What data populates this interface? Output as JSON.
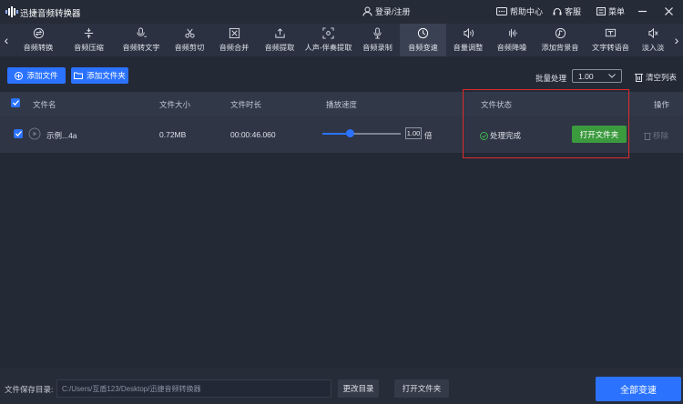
{
  "app": {
    "title": "迅捷音频转换器",
    "login": "登录/注册",
    "help": "帮助中心",
    "service": "客服",
    "menu": "菜单"
  },
  "tabs": [
    {
      "label": "音频转换",
      "icon": "convert-icon"
    },
    {
      "label": "音频压缩",
      "icon": "compress-icon"
    },
    {
      "label": "音频转文字",
      "icon": "speech-to-text-icon"
    },
    {
      "label": "音频剪切",
      "icon": "scissors-icon"
    },
    {
      "label": "音频合并",
      "icon": "merge-icon"
    },
    {
      "label": "音频提取",
      "icon": "extract-icon"
    },
    {
      "label": "人声-伴奏提取",
      "icon": "vocal-extract-icon"
    },
    {
      "label": "音频录制",
      "icon": "microphone-icon"
    },
    {
      "label": "音频变速",
      "icon": "clock-icon",
      "active": true
    },
    {
      "label": "音量调整",
      "icon": "volume-icon"
    },
    {
      "label": "音频降噪",
      "icon": "denoise-icon"
    },
    {
      "label": "添加背景音",
      "icon": "background-music-icon"
    },
    {
      "label": "文字转语音",
      "icon": "text-to-speech-icon"
    },
    {
      "label": "淡入淡",
      "icon": "fade-icon"
    }
  ],
  "actions": {
    "add_file": "添加文件",
    "add_folder": "添加文件夹",
    "batch_label": "批量处理",
    "batch_value": "1.00",
    "clear_list": "清空列表"
  },
  "table": {
    "headers": {
      "name": "文件名",
      "size": "文件大小",
      "duration": "文件时长",
      "speed": "播放速度",
      "status": "文件状态",
      "ops": "操作"
    },
    "rows": [
      {
        "name": "示例...4a",
        "size": "0.72MB",
        "duration": "00:00:46.060",
        "speed_value": "1.00",
        "speed_unit": "倍",
        "status": "处理完成",
        "open_folder": "打开文件夹",
        "remove": "移除"
      }
    ]
  },
  "bottom": {
    "save_label": "文件保存目录:",
    "path": "C:/Users/互盾123/Desktop/迅捷音频转换器",
    "change_dir": "更改目录",
    "open_folder": "打开文件夹",
    "convert_all": "全部变速"
  },
  "colors": {
    "accent": "#2b73ff",
    "success": "#3b9a3e",
    "highlight": "#e02c2c",
    "background": "#242936"
  }
}
